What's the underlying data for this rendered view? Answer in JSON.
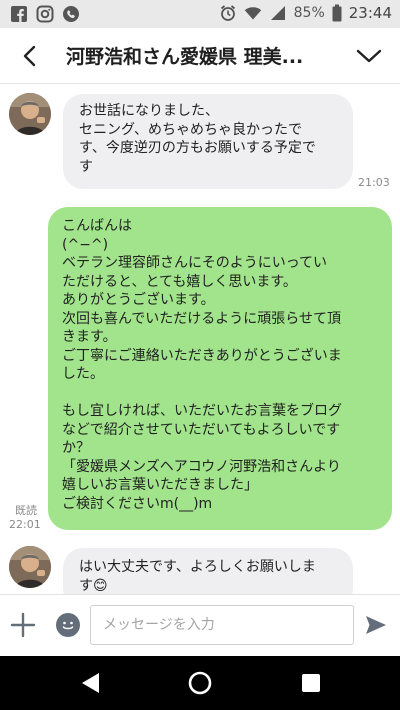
{
  "status_bar": {
    "battery": "85%",
    "time": "23:44"
  },
  "header": {
    "title": "河野浩和さん愛媛県 理美..."
  },
  "messages": [
    {
      "direction": "incoming",
      "text": "お世話になりました、\nセニング、めちゃめちゃ良かったで\nす、今度逆刃の方もお願いする予定で\nす",
      "time": "21:03"
    },
    {
      "direction": "outgoing",
      "text": "こんばんは\n(^−^)\nベテラン理容師さんにそのようにいってい\nただけると、とても嬉しく思います。\nありがとうございます。\n次回も喜んでいただけるように頑張らせて頂\nきます。\nご丁寧にご連絡いただきありがとうございま\nした。\n\nもし宜しければ、いただいたお言葉をブログ\nなどで紹介させていただいてもよろしいです\nか？\n「愛媛県メンズヘアコウノ河野浩和さんより\n嬉しいお言葉いただきました」\nご検討くださいm(__)m",
      "read_label": "既読",
      "time": "22:01"
    },
    {
      "direction": "incoming",
      "text": "はい大丈夫です、よろしくお願いしま\nす😊"
    }
  ],
  "input": {
    "placeholder": "メッセージを入力"
  },
  "colors": {
    "outgoing_bubble": "#a1e48b",
    "incoming_bubble": "#efeff1",
    "status_bar": "#e9e9e9",
    "nav_bar": "#000000"
  }
}
